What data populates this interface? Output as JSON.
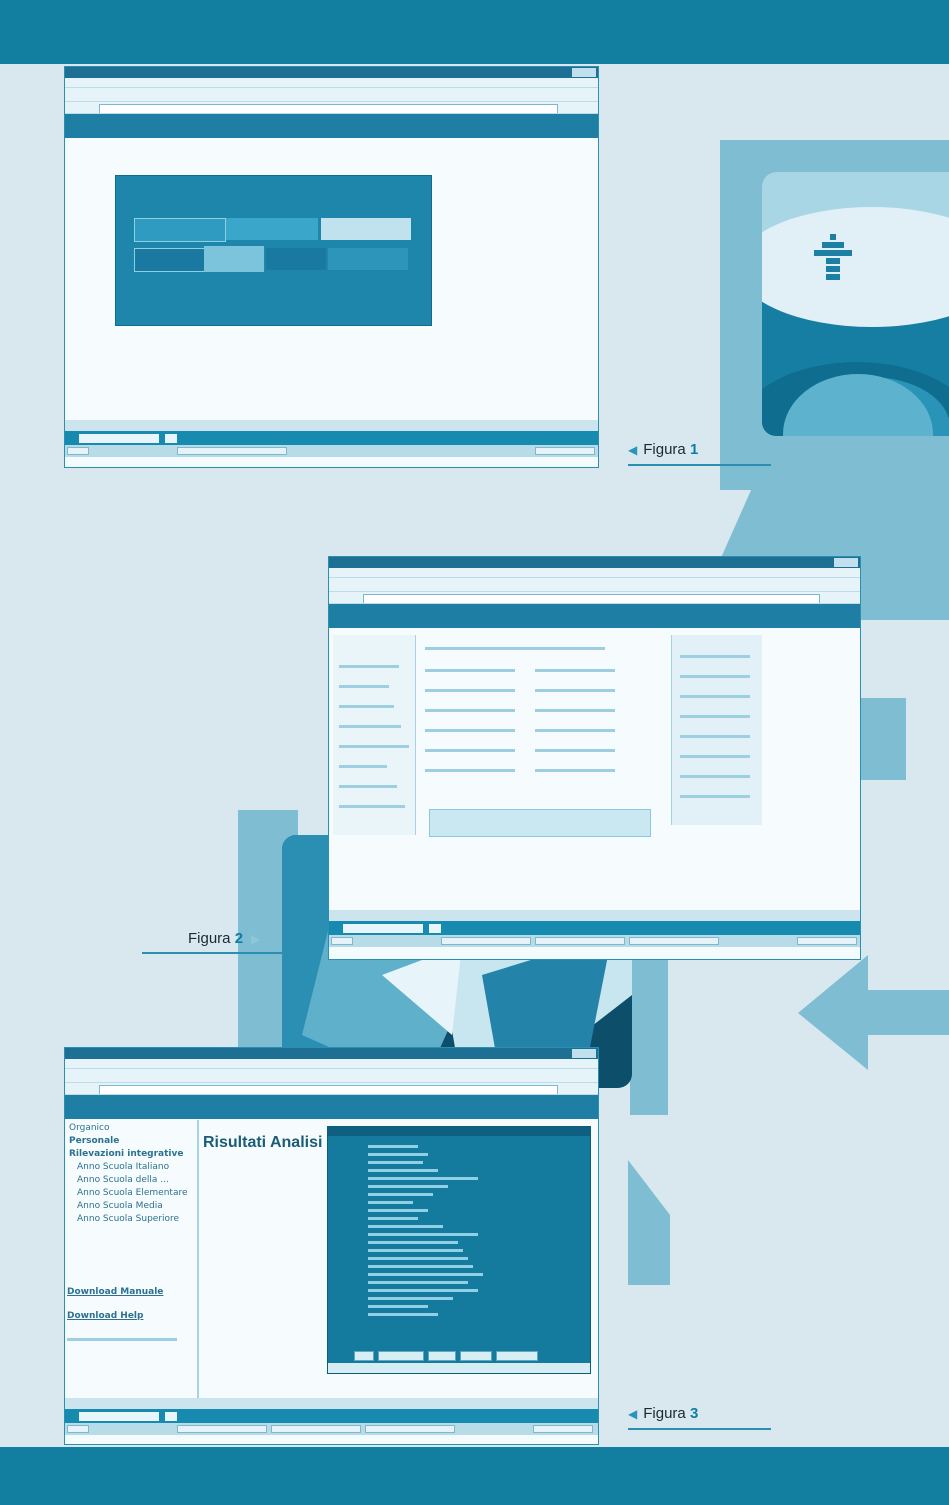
{
  "figures": [
    {
      "label": "Figura",
      "number": "1"
    },
    {
      "label": "Figura",
      "number": "2"
    },
    {
      "label": "Figura",
      "number": "3"
    }
  ],
  "figure3_screen": {
    "heading": "Risultati Analisi",
    "nav_items": [
      "Organico",
      "Personale",
      "Rilevazioni integrative",
      "Anno Scuola Italiano",
      "Anno Scuola della ...",
      "Anno Scuola Elementare",
      "Anno Scuola Media",
      "Anno Scuola Superiore"
    ],
    "footer_links": [
      "Download Manuale",
      "Download Help"
    ]
  },
  "colors": {
    "band": "#137fa0",
    "page_background": "#d9e8ee",
    "decor": "#7fbdd3",
    "accent_number": "#0f7da3"
  }
}
